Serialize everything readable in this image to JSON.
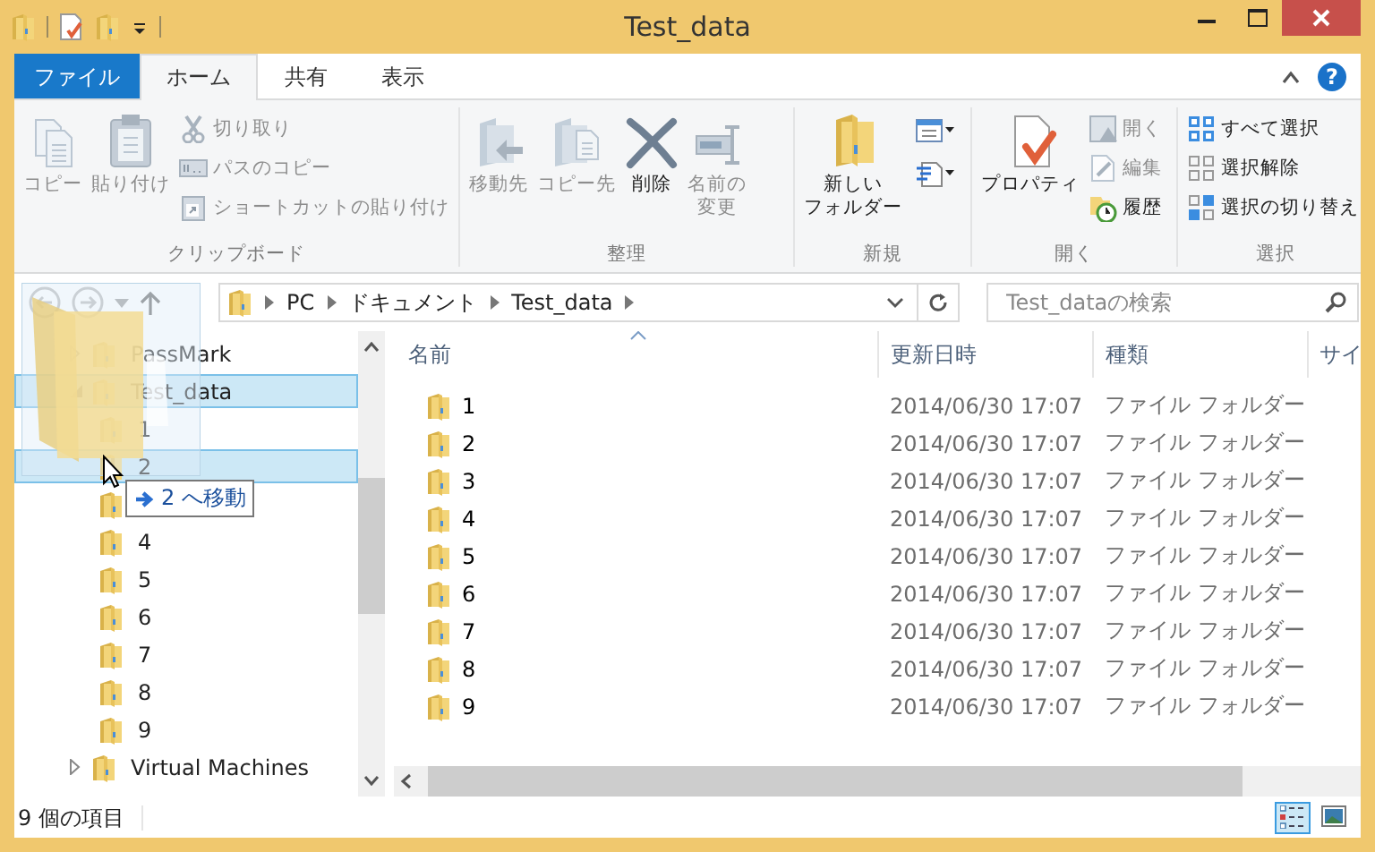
{
  "window": {
    "title": "Test_data"
  },
  "ribbon": {
    "tabs": [
      {
        "label": "ファイル",
        "kind": "file",
        "selected": false
      },
      {
        "label": "ホーム",
        "kind": "tab",
        "selected": true
      },
      {
        "label": "共有",
        "kind": "tab",
        "selected": false
      },
      {
        "label": "表示",
        "kind": "tab",
        "selected": false
      }
    ],
    "help": "?",
    "groups": [
      {
        "label": "クリップボード",
        "items": [
          {
            "label": [
              "コピー"
            ],
            "kind": "large",
            "disabled": true
          },
          {
            "label": [
              "貼り付け"
            ],
            "kind": "large",
            "disabled": true
          },
          {
            "label": "切り取り",
            "kind": "small",
            "disabled": true
          },
          {
            "label": "パスのコピー",
            "kind": "small",
            "disabled": true
          },
          {
            "label": "ショートカットの貼り付け",
            "kind": "small",
            "disabled": true
          }
        ]
      },
      {
        "label": "整理",
        "items": [
          {
            "label": [
              "移動先"
            ],
            "kind": "large",
            "disabled": true
          },
          {
            "label": [
              "コピー先"
            ],
            "kind": "large",
            "disabled": true
          },
          {
            "label": [
              "削除"
            ],
            "kind": "large",
            "disabled": false
          },
          {
            "label": [
              "名前の",
              "変更"
            ],
            "kind": "large",
            "disabled": true
          }
        ]
      },
      {
        "label": "新規",
        "items": [
          {
            "label": [
              "新しい",
              "フォルダー"
            ],
            "kind": "large",
            "disabled": false
          },
          {
            "kind": "icon",
            "disabled": false
          },
          {
            "kind": "icon",
            "disabled": false
          }
        ]
      },
      {
        "label": "開く",
        "items": [
          {
            "label": [
              "プロパティ"
            ],
            "kind": "large",
            "disabled": false
          },
          {
            "label": "開く",
            "kind": "small",
            "disabled": true
          },
          {
            "label": "編集",
            "kind": "small",
            "disabled": true
          },
          {
            "label": "履歴",
            "kind": "small",
            "disabled": false
          }
        ]
      },
      {
        "label": "選択",
        "items": [
          {
            "label": "すべて選択",
            "kind": "small",
            "disabled": false
          },
          {
            "label": "選択解除",
            "kind": "small",
            "disabled": false
          },
          {
            "label": "選択の切り替え",
            "kind": "small",
            "disabled": false
          }
        ]
      }
    ]
  },
  "address": {
    "path": [
      "PC",
      "ドキュメント",
      "Test_data"
    ],
    "search": {
      "placeholder": "Test_dataの検索"
    }
  },
  "tree": [
    {
      "label": "PassMark",
      "expanded": false,
      "selected": false
    },
    {
      "label": "Test_data",
      "expanded": true,
      "selected": true,
      "children": [
        {
          "label": "1",
          "selected": false
        },
        {
          "label": "2",
          "selected": true
        },
        {
          "selected": false
        },
        {
          "label": "4",
          "selected": false
        },
        {
          "label": "5",
          "selected": false
        },
        {
          "label": "6",
          "selected": false
        },
        {
          "label": "7",
          "selected": false
        },
        {
          "label": "8",
          "selected": false
        },
        {
          "label": "9",
          "selected": false
        }
      ]
    },
    {
      "label": "Virtual Machines",
      "expanded": false,
      "selected": false
    }
  ],
  "drag": {
    "tooltip": "2 へ移動"
  },
  "table": {
    "columns": [
      "名前",
      "更新日時",
      "種類",
      "サイ"
    ],
    "rows": [
      {
        "name": "1",
        "modified": "2014/06/30 17:07",
        "type": "ファイル フォルダー"
      },
      {
        "name": "2",
        "modified": "2014/06/30 17:07",
        "type": "ファイル フォルダー"
      },
      {
        "name": "3",
        "modified": "2014/06/30 17:07",
        "type": "ファイル フォルダー"
      },
      {
        "name": "4",
        "modified": "2014/06/30 17:07",
        "type": "ファイル フォルダー"
      },
      {
        "name": "5",
        "modified": "2014/06/30 17:07",
        "type": "ファイル フォルダー"
      },
      {
        "name": "6",
        "modified": "2014/06/30 17:07",
        "type": "ファイル フォルダー"
      },
      {
        "name": "7",
        "modified": "2014/06/30 17:07",
        "type": "ファイル フォルダー"
      },
      {
        "name": "8",
        "modified": "2014/06/30 17:07",
        "type": "ファイル フォルダー"
      },
      {
        "name": "9",
        "modified": "2014/06/30 17:07",
        "type": "ファイル フォルダー"
      }
    ]
  },
  "status_bar": {
    "text": "9 個の項目",
    "views": [
      {
        "kind": "details",
        "selected": true
      },
      {
        "kind": "large-icons",
        "selected": false
      }
    ]
  }
}
